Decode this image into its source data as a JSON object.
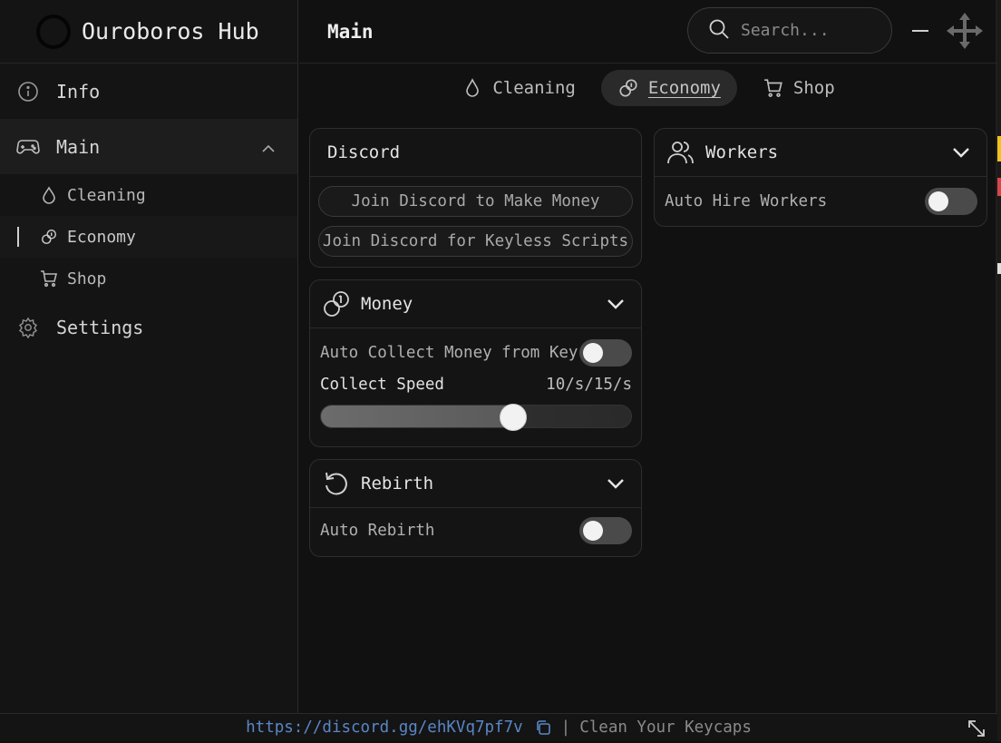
{
  "app": {
    "title": "Ouroboros Hub"
  },
  "header": {
    "title": "Main"
  },
  "search": {
    "placeholder": "Search..."
  },
  "sidebar": {
    "items": [
      {
        "label": "Info",
        "icon": "info-icon"
      },
      {
        "label": "Main",
        "icon": "gamepad-icon",
        "expanded": true
      },
      {
        "label": "Settings",
        "icon": "gear-icon"
      }
    ],
    "subitems": [
      {
        "label": "Cleaning",
        "icon": "droplet-icon"
      },
      {
        "label": "Economy",
        "icon": "coins-icon",
        "active": true
      },
      {
        "label": "Shop",
        "icon": "cart-icon"
      }
    ]
  },
  "tabs": [
    {
      "label": "Cleaning",
      "icon": "droplet-icon"
    },
    {
      "label": "Economy",
      "icon": "coins-icon",
      "active": true
    },
    {
      "label": "Shop",
      "icon": "cart-icon"
    }
  ],
  "discord": {
    "title": "Discord",
    "buttons": [
      "Join Discord to Make Money",
      "Join Discord for Keyless Scripts"
    ]
  },
  "money": {
    "title": "Money",
    "auto_collect_label": "Auto Collect Money from Keycaps",
    "auto_collect_on": false,
    "speed_label": "Collect Speed",
    "speed_value": "10/s/15/s",
    "speed_fraction": 0.62
  },
  "rebirth": {
    "title": "Rebirth",
    "auto_rebirth_label": "Auto Rebirth",
    "auto_rebirth_on": false
  },
  "workers": {
    "title": "Workers",
    "auto_hire_label": "Auto Hire Workers",
    "auto_hire_on": false
  },
  "footer": {
    "link": "https://discord.gg/ehKVq7pf7v",
    "separator": "|",
    "tagline": "Clean Your Keycaps"
  },
  "colors": {
    "background": "#111111",
    "accent_link": "#5a86c6",
    "toggle_off": "#4a4a4a"
  }
}
